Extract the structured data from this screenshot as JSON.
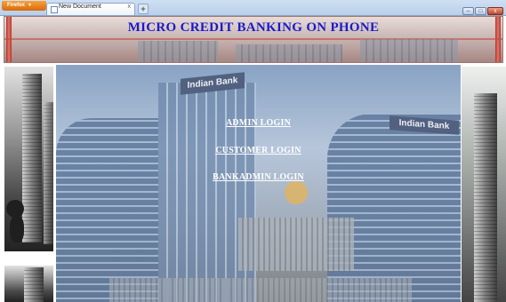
{
  "browser": {
    "app_button_label": "Firefox",
    "tab_title": "New Document",
    "tab_close_glyph": "x",
    "new_tab_glyph": "+",
    "window_controls": [
      "–",
      "□",
      "x"
    ]
  },
  "header": {
    "title": "MICRO CREDIT BANKING ON PHONE"
  },
  "main": {
    "building_sign_left": "Indian Bank",
    "building_sign_right": "Indian Bank",
    "links": [
      {
        "label": "ADMIN LOGIN"
      },
      {
        "label": "CUSTOMER LOGIN"
      },
      {
        "label": "BANKADMIN LOGIN"
      }
    ]
  },
  "colors": {
    "title": "#1a1ac8",
    "link": "#ffffff",
    "header_bg": "#c9b8b5",
    "browser_chrome": "#cfe0f4",
    "firefox_button": "#e8801f"
  }
}
